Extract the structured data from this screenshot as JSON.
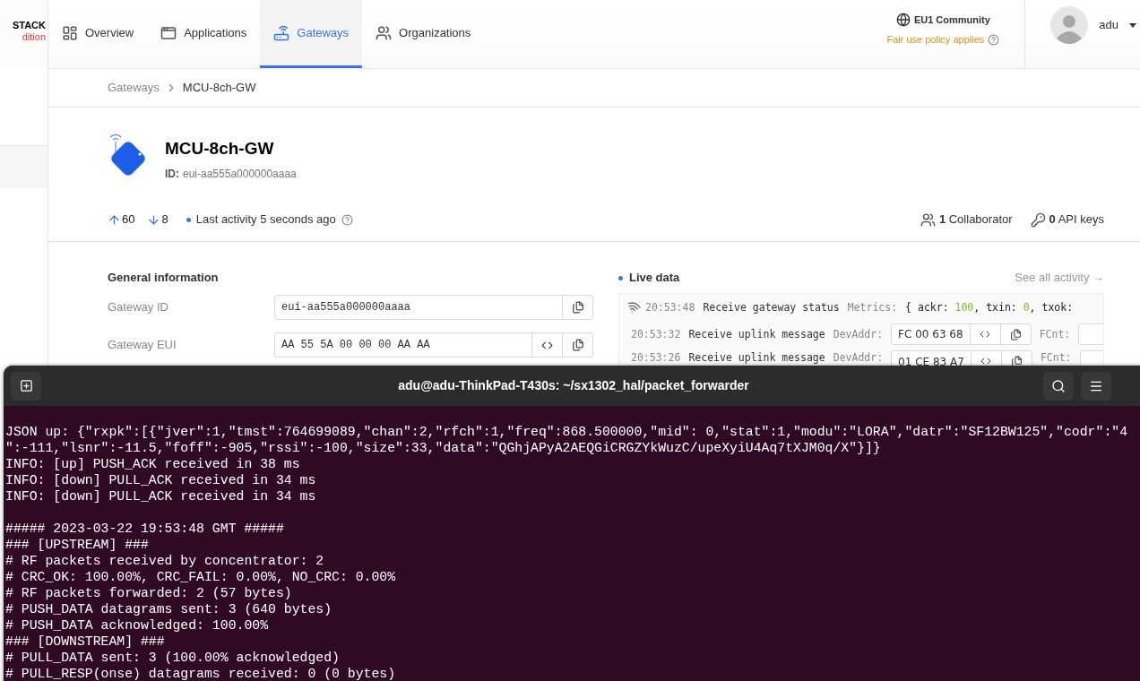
{
  "brand": {
    "line_1": "STACK",
    "line_2": "dition"
  },
  "nav": [
    {
      "label": "Overview",
      "selected": false
    },
    {
      "label": "Applications",
      "selected": false
    },
    {
      "label": "Gateways",
      "selected": true
    },
    {
      "label": "Organizations",
      "selected": false
    }
  ],
  "cluster": {
    "name": "EU1 Community",
    "note": "Fair use policy applies"
  },
  "user": {
    "name": "adu"
  },
  "breadcrumb": [
    "Gateways",
    "MCU-8ch-GW"
  ],
  "gateway": {
    "name": "MCU-8ch-GW",
    "id_label": "ID:",
    "id": "eui-aa555a000000aaaa"
  },
  "stats": {
    "uplink": "60",
    "downlink": "8",
    "activity": "Last activity 5 seconds ago",
    "collaborators_count": "1",
    "collaborators": "Collaborator",
    "api_keys_count": "0",
    "api_keys": "API keys"
  },
  "general": {
    "title": "General information",
    "rows": [
      {
        "label": "Gateway ID",
        "value": "eui-aa555a000000aaaa",
        "byte_toggle": false
      },
      {
        "label": "Gateway EUI",
        "value": "AA 55 5A 00 00 00 AA AA",
        "byte_toggle": true
      }
    ]
  },
  "live": {
    "title": "Live data",
    "link": "See all activity →",
    "rows": [
      {
        "kind": "status",
        "time": "20:53:48",
        "event": "Receive gateway status",
        "key": "Metrics:",
        "parts": [
          {
            "text": "{ ackr: ",
            "kind": "plain"
          },
          {
            "text": "100",
            "kind": "number"
          },
          {
            "text": ", txin: ",
            "kind": "plain"
          },
          {
            "text": "0",
            "kind": "number"
          },
          {
            "text": ", txok: ",
            "kind": "plain"
          }
        ]
      },
      {
        "kind": "uplink",
        "time": "20:53:32",
        "event": "Receive uplink message",
        "key": "DevAddr:",
        "value": "FC 00 63 68",
        "extra": "FCnt:"
      },
      {
        "kind": "uplink",
        "time": "20:53:26",
        "event": "Receive uplink message",
        "key": "DevAddr:",
        "value": "01 CE 83 A7",
        "extra": "FCnt:"
      }
    ]
  },
  "terminal": {
    "title": "adu@adu-ThinkPad-T430s: ~/sx1302_hal/packet_forwarder",
    "blocks": [
      [
        "JSON up: {\"rxpk\":[{\"jver\":1,\"tmst\":764699089,\"chan\":2,\"rfch\":1,\"freq\":868.500000,\"mid\": 0,\"stat\":1,\"modu\":\"LORA\",\"datr\":\"SF12BW125\",\"codr\":\"4",
        "\":-111,\"lsnr\":-11.5,\"foff\":-905,\"rssi\":-100,\"size\":33,\"data\":\"QGhjAPyA2AEQGiCRGZYkWuzC/upeXyiU4Aq7tXJM0q/X\"}]}",
        "INFO: [up] PUSH_ACK received in 38 ms",
        "INFO: [down] PULL_ACK received in 34 ms",
        "INFO: [down] PULL_ACK received in 34 ms"
      ],
      [
        "##### 2023-03-22 19:53:48 GMT #####",
        "### [UPSTREAM] ###",
        "# RF packets received by concentrator: 2",
        "# CRC_OK: 100.00%, CRC_FAIL: 0.00%, NO_CRC: 0.00%",
        "# RF packets forwarded: 2 (57 bytes)",
        "# PUSH_DATA datagrams sent: 3 (640 bytes)",
        "# PUSH_DATA acknowledged: 100.00%",
        "### [DOWNSTREAM] ###",
        "# PULL_DATA sent: 3 (100.00% acknowledged)",
        "# PULL_RESP(onse) datagrams received: 0 (0 bytes)"
      ]
    ]
  }
}
